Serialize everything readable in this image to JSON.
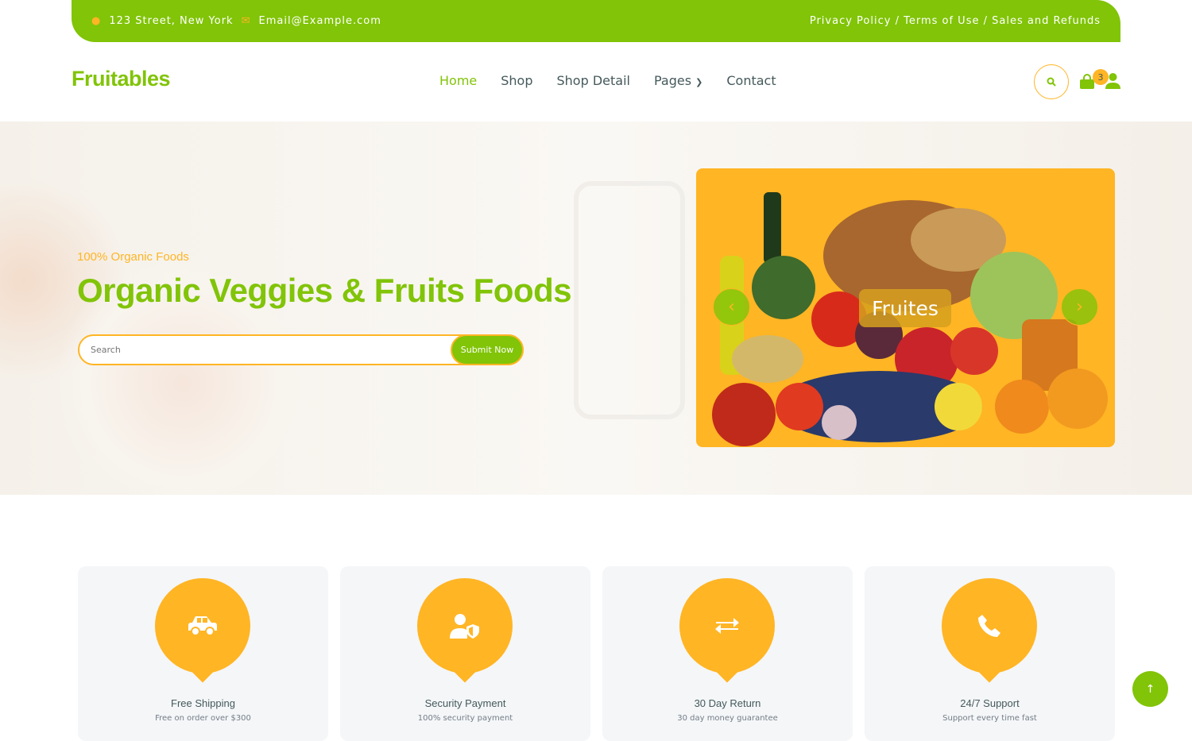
{
  "topbar": {
    "address": "123 Street, New York",
    "email": "Email@Example.com",
    "links": [
      "Privacy Policy",
      "Terms of Use",
      "Sales and Refunds"
    ],
    "separator": " / "
  },
  "header": {
    "logo": "Fruitables",
    "nav": [
      "Home",
      "Shop",
      "Shop Detail",
      "Pages",
      "Contact"
    ],
    "active": "Home",
    "cart_count": "3"
  },
  "hero": {
    "subtitle": "100% Organic Foods",
    "title": "Organic Veggies & Fruits Foods",
    "search_placeholder": "Search",
    "submit_label": "Submit Now",
    "carousel_caption": "Fruites"
  },
  "features": [
    {
      "icon": "car-icon",
      "title": "Free Shipping",
      "text": "Free on order over $300"
    },
    {
      "icon": "user-shield-icon",
      "title": "Security Payment",
      "text": "100% security payment"
    },
    {
      "icon": "exchange-icon",
      "title": "30 Day Return",
      "text": "30 day money guarantee"
    },
    {
      "icon": "phone-icon",
      "title": "24/7 Support",
      "text": "Support every time fast"
    }
  ],
  "colors": {
    "primary": "#81c408",
    "secondary": "#ffb524",
    "text": "#45595b"
  }
}
